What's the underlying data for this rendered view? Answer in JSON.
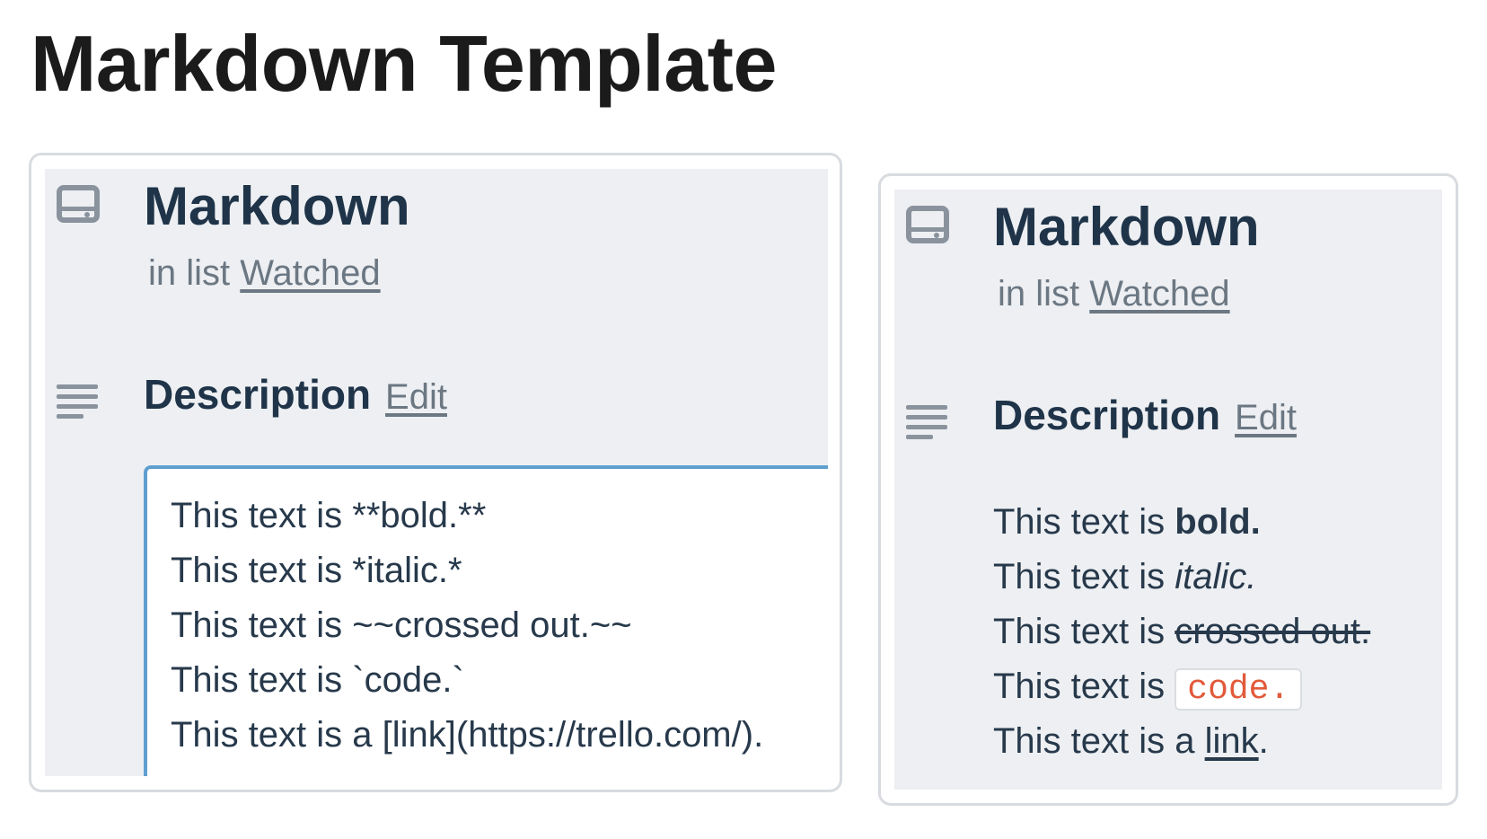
{
  "page_title": "Markdown Template",
  "left_card": {
    "title": "Markdown",
    "list_prefix": "in list",
    "list_name": "Watched",
    "description_label": "Description",
    "edit_label": "Edit",
    "editor_lines": [
      "This text is **bold.**",
      "This text is *italic.*",
      "This text is ~~crossed out.~~",
      "This text is `code.`",
      "This text is a [link](https://trello.com/)."
    ]
  },
  "right_card": {
    "title": "Markdown",
    "list_prefix": "in list",
    "list_name": "Watched",
    "description_label": "Description",
    "edit_label": "Edit",
    "rendered_lines": [
      {
        "prefix": "This text is ",
        "styled": "bold.",
        "style": "bold",
        "suffix": ""
      },
      {
        "prefix": "This text is ",
        "styled": "italic.",
        "style": "italic",
        "suffix": ""
      },
      {
        "prefix": "This text is ",
        "styled": "crossed out.",
        "style": "strikethrough",
        "suffix": ""
      },
      {
        "prefix": "This text is ",
        "styled": "code.",
        "style": "code",
        "suffix": ""
      },
      {
        "prefix": "This text is a ",
        "styled": "link",
        "style": "link",
        "suffix": "."
      }
    ]
  },
  "icons": {
    "card": "card-icon",
    "description": "description-lines-icon"
  },
  "colors": {
    "panel_bg": "#edeff2",
    "heading": "#1f3449",
    "muted": "#6b7782",
    "editor_border": "#5f9fcf",
    "code_text": "#e25a3a"
  }
}
